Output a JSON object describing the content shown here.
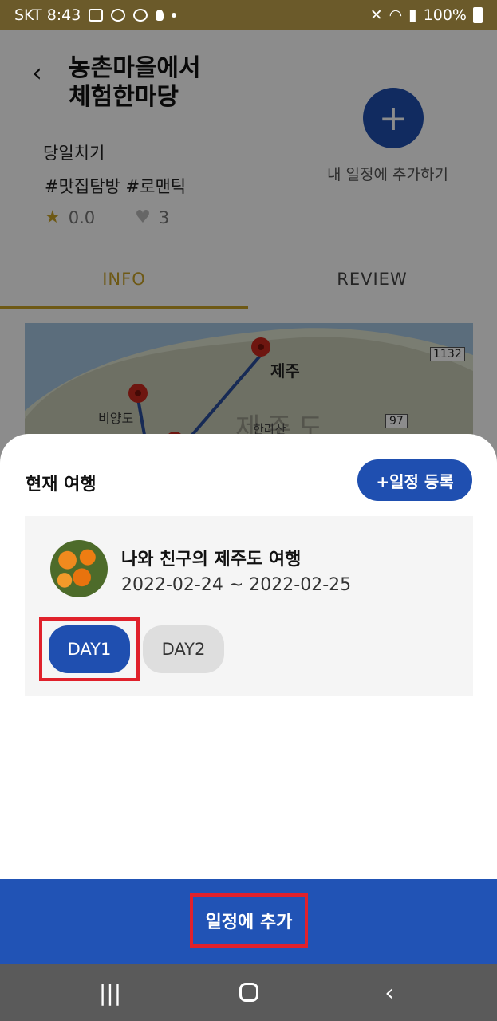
{
  "status_bar": {
    "carrier_time": "SKT 8:43",
    "battery": "100%"
  },
  "header": {
    "title_line1": "농촌마을에서",
    "title_line2": "체험한마당"
  },
  "detail": {
    "category": "당일치기",
    "tags": "#맛집탐방 #로맨틱",
    "rating": "0.0",
    "likes": "3",
    "add_to_schedule_label": "내 일정에 추가하기"
  },
  "tabs": [
    {
      "label": "INFO"
    },
    {
      "label": "REVIEW"
    }
  ],
  "map": {
    "labels": [
      "제주",
      "비양도",
      "제주도",
      "한라산",
      "1132",
      "97"
    ]
  },
  "sheet": {
    "title": "현재 여행",
    "register_button": "+일정 등록",
    "trip": {
      "name": "나와 친구의 제주도 여행",
      "dates": "2022-02-24 ~ 2022-02-25"
    },
    "days": [
      {
        "label": "DAY1",
        "selected": true
      },
      {
        "label": "DAY2",
        "selected": false
      }
    ]
  },
  "action": {
    "add_label": "일정에 추가"
  },
  "colors": {
    "primary": "#1f4fb0",
    "accent": "#c9a227",
    "highlight": "#e0212b"
  }
}
